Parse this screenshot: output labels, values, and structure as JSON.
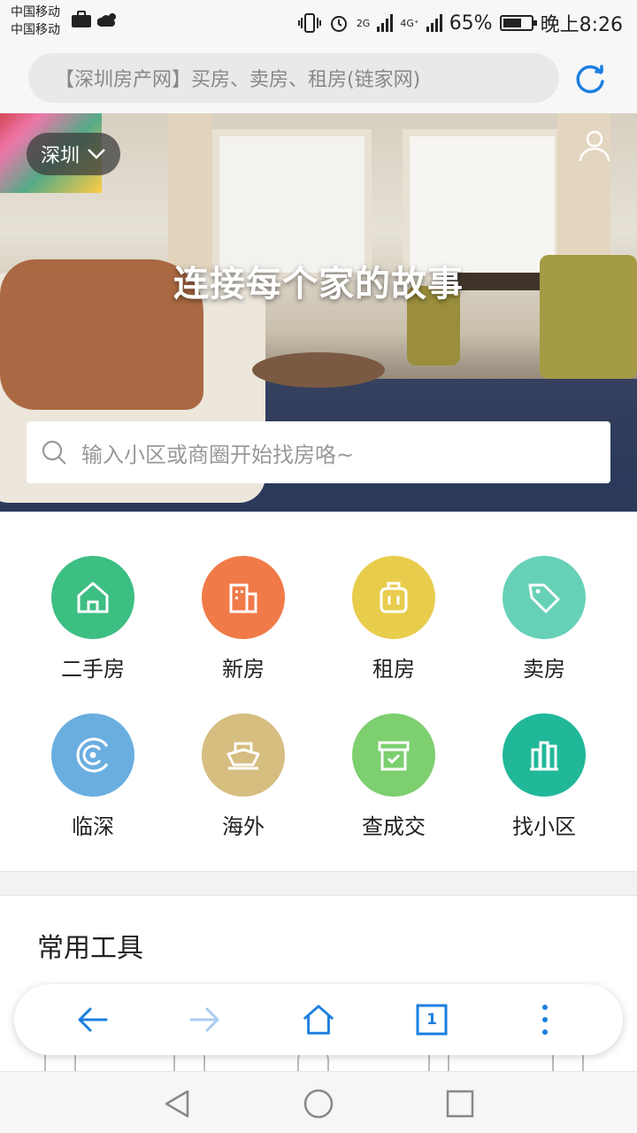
{
  "status_bar": {
    "carrier1": "中国移动",
    "carrier2": "中国移动",
    "network1": "2G",
    "network2": "4G⁺",
    "battery": "65%",
    "time": "晚上8:26"
  },
  "url_bar": {
    "title": "【深圳房产网】买房、卖房、租房(链家网)"
  },
  "hero": {
    "city": "深圳",
    "slogan": "连接每个家的故事",
    "search_placeholder": "输入小区或商圈开始找房咯~"
  },
  "categories": [
    {
      "label": "二手房",
      "color": "#3dbe82",
      "icon": "house-icon"
    },
    {
      "label": "新房",
      "color": "#f07a48",
      "icon": "building-icon"
    },
    {
      "label": "租房",
      "color": "#e8cc4c",
      "icon": "luggage-icon"
    },
    {
      "label": "卖房",
      "color": "#67d1b7",
      "icon": "tag-icon"
    },
    {
      "label": "临深",
      "color": "#6aaee0",
      "icon": "target-icon"
    },
    {
      "label": "海外",
      "color": "#d6bd80",
      "icon": "ship-icon"
    },
    {
      "label": "查成交",
      "color": "#7dcf6f",
      "icon": "archive-icon"
    },
    {
      "label": "找小区",
      "color": "#21b89a",
      "icon": "buildings-icon"
    }
  ],
  "tools": {
    "title": "常用工具"
  },
  "browser_nav": {
    "tab_count": "1",
    "accent": "#1b7fe0"
  }
}
